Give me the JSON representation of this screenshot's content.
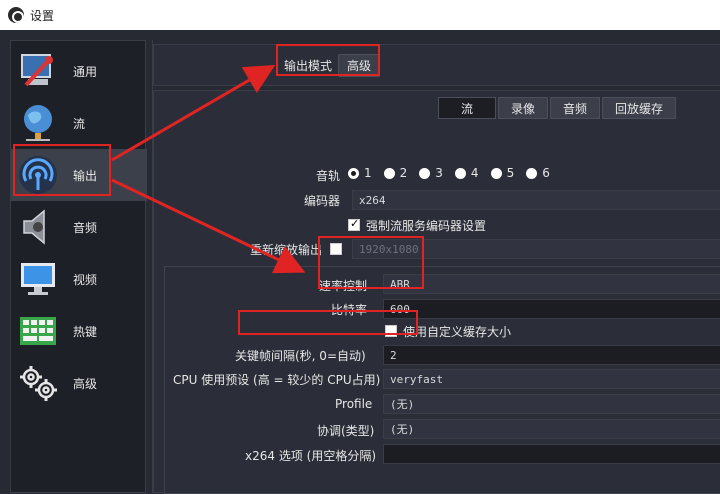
{
  "window": {
    "title": "设置"
  },
  "sidebar": {
    "items": [
      {
        "label": "通用",
        "icon": "computer-wrench-icon"
      },
      {
        "label": "流",
        "icon": "globe-network-icon"
      },
      {
        "label": "输出",
        "icon": "broadcast-antenna-icon",
        "selected": true
      },
      {
        "label": "音频",
        "icon": "speaker-icon"
      },
      {
        "label": "视频",
        "icon": "monitor-icon"
      },
      {
        "label": "热键",
        "icon": "keyboard-icon"
      },
      {
        "label": "高级",
        "icon": "gears-icon"
      }
    ]
  },
  "output_mode": {
    "label": "输出模式",
    "value": "高级"
  },
  "tabs": [
    "流",
    "录像",
    "音频",
    "回放缓存"
  ],
  "audio_track": {
    "label": "音轨",
    "options": [
      "1",
      "2",
      "3",
      "4",
      "5",
      "6"
    ],
    "selected": "1"
  },
  "encoder": {
    "label": "编码器",
    "value": "x264"
  },
  "enforce_encoder": {
    "label": "强制流服务编码器设置",
    "checked": true
  },
  "rescale": {
    "label": "重新缩放输出",
    "checked": false,
    "value": "1920x1080"
  },
  "rate_control": {
    "label": "速率控制",
    "value": "ABR"
  },
  "bitrate": {
    "label": "比特率",
    "value": "600"
  },
  "custom_buffer": {
    "label": "使用自定义缓存大小",
    "checked": false
  },
  "keyframe": {
    "label": "关键帧间隔(秒, 0=自动)",
    "value": "2"
  },
  "cpu_preset": {
    "label": "CPU 使用预设 (高 = 较少的 CPU占用)",
    "value": "veryfast"
  },
  "profile": {
    "label": "Profile",
    "value": "(无)"
  },
  "tune": {
    "label": "协调(类型)",
    "value": "(无)"
  },
  "x264_options": {
    "label": "x264 选项 (用空格分隔)",
    "value": ""
  },
  "colors": {
    "highlight_red": "#e02424",
    "background": "#272a33",
    "selected_item": "#3c404b"
  }
}
